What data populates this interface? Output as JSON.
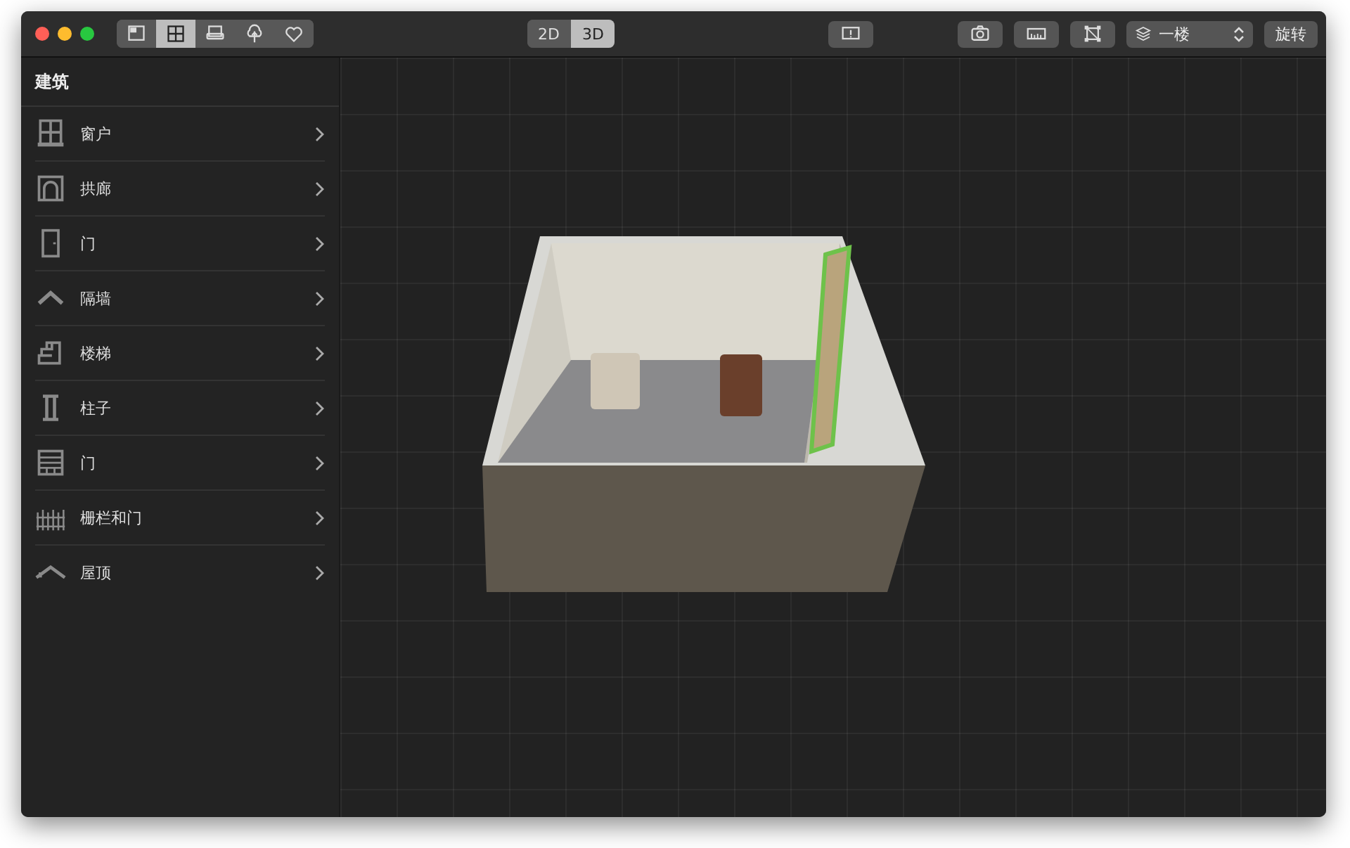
{
  "toolbar": {
    "view_buttons": [
      {
        "kind": "plan",
        "selected": false
      },
      {
        "kind": "grid",
        "selected": true
      },
      {
        "kind": "sofa",
        "selected": false
      },
      {
        "kind": "tree",
        "selected": false
      },
      {
        "kind": "heart",
        "selected": false
      }
    ],
    "mode_tabs": [
      {
        "label": "2D",
        "selected": false
      },
      {
        "label": "3D",
        "selected": true
      }
    ],
    "tools": [
      {
        "kind": "feedback"
      },
      {
        "kind": "camera"
      },
      {
        "kind": "ruler"
      },
      {
        "kind": "crop"
      }
    ],
    "floor_select": {
      "value": "一楼"
    },
    "rotate_button": "旋转"
  },
  "sidebar": {
    "title": "建筑",
    "items": [
      {
        "label": "窗户",
        "kind": "window"
      },
      {
        "label": "拱廊",
        "kind": "arch"
      },
      {
        "label": "门",
        "kind": "door"
      },
      {
        "label": "隔墙",
        "kind": "partition"
      },
      {
        "label": "楼梯",
        "kind": "stairs"
      },
      {
        "label": "柱子",
        "kind": "column"
      },
      {
        "label": "门",
        "kind": "shutter"
      },
      {
        "label": "栅栏和门",
        "kind": "fence"
      },
      {
        "label": "屋顶",
        "kind": "roof"
      }
    ]
  }
}
